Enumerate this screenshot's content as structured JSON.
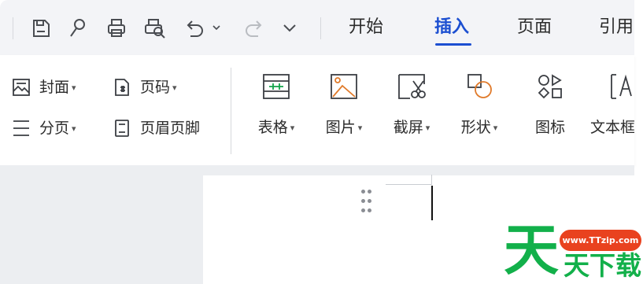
{
  "quick_access": {
    "icons": [
      "save-icon",
      "format-painter-icon",
      "print-icon",
      "print-preview-icon",
      "undo-icon",
      "redo-icon",
      "customize-toolbar-icon"
    ]
  },
  "tabs": [
    {
      "label": "开始"
    },
    {
      "label": "插入"
    },
    {
      "label": "页面"
    },
    {
      "label": "引用"
    }
  ],
  "active_tab": "插入",
  "ribbon": {
    "small_buttons": [
      {
        "label": "封面",
        "has_dropdown": true
      },
      {
        "label": "页码",
        "has_dropdown": true
      },
      {
        "label": "分页",
        "has_dropdown": true
      },
      {
        "label": "页眉页脚",
        "has_dropdown": false
      }
    ],
    "big_buttons": [
      {
        "label": "表格",
        "has_dropdown": true
      },
      {
        "label": "图片",
        "has_dropdown": true
      },
      {
        "label": "截屏",
        "has_dropdown": true
      },
      {
        "label": "形状",
        "has_dropdown": true
      },
      {
        "label": "图标",
        "has_dropdown": false
      },
      {
        "label": "文本框",
        "has_dropdown": false
      }
    ]
  },
  "watermark": {
    "url": "www.TTzip.com",
    "big_char": "天",
    "text": "天下载"
  },
  "colors": {
    "accent": "#1c4fd1",
    "watermark_green": "#12b04a",
    "watermark_red": "#e9421f"
  }
}
